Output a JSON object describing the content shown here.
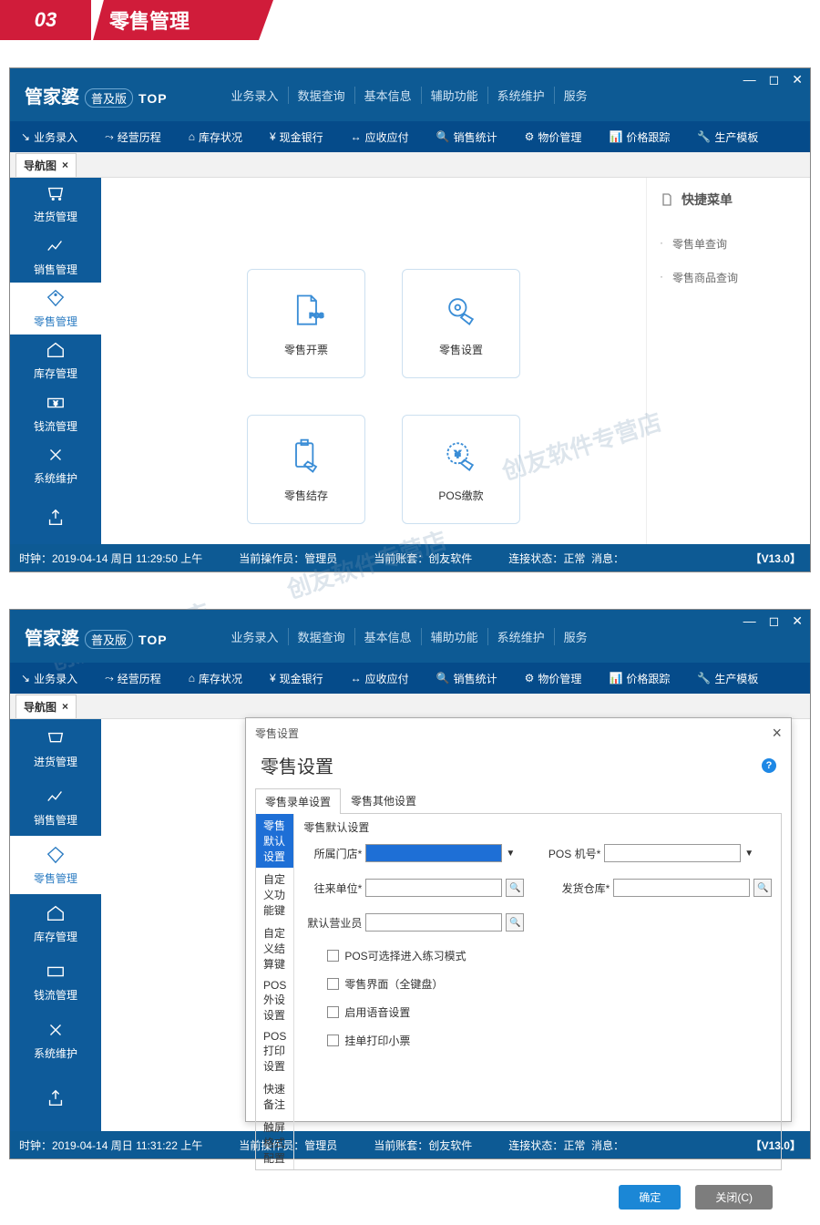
{
  "page_header": {
    "num": "03",
    "title": "零售管理"
  },
  "app": {
    "logo_main": "管家婆",
    "logo_sub": "普及版",
    "logo_top": "TOP",
    "top_menu": [
      "业务录入",
      "数据查询",
      "基本信息",
      "辅助功能",
      "系统维护",
      "服务"
    ],
    "toolbar": [
      "业务录入",
      "经营历程",
      "库存状况",
      "现金银行",
      "应收应付",
      "销售统计",
      "物价管理",
      "价格跟踪",
      "生产模板"
    ],
    "toolbar_prefix": [
      "↘",
      "⤳",
      "⌂",
      "¥",
      "↔",
      "🔍",
      "⚙",
      "📊",
      "🔧"
    ],
    "nav_tab": "导航图",
    "sidebar": [
      "进货管理",
      "销售管理",
      "零售管理",
      "库存管理",
      "钱流管理",
      "系统维护",
      ""
    ],
    "sidebar_active_index": 2
  },
  "screen1": {
    "cards": [
      "零售开票",
      "零售设置",
      "零售结存",
      "POS缴款"
    ],
    "quick_header": "快捷菜单",
    "quick_links": [
      "零售单查询",
      "零售商品查询"
    ],
    "status": {
      "clock_label": "时钟：",
      "clock": "2019-04-14 周日 11:29:50 上午",
      "operator_label": "当前操作员：",
      "operator": "管理员",
      "account_label": "当前账套：",
      "account": "创友软件",
      "conn_label": "连接状态：",
      "conn": "正常",
      "msg_label": "消息：",
      "version": "【V13.0】"
    }
  },
  "screen2": {
    "dialog": {
      "breadcrumb": "零售设置",
      "title": "零售设置",
      "tabs": [
        "零售录单设置",
        "零售其他设置"
      ],
      "active_tab": 0,
      "side_items": [
        "零售默认设置",
        "自定义功能键",
        "自定义结算键",
        "POS外设设置",
        "POS打印设置",
        "快速备注",
        "触屏格式配置"
      ],
      "side_active": 0,
      "section_label": "零售默认设置",
      "fields": {
        "store_label": "所属门店*",
        "pos_no_label": "POS 机号*",
        "supplier_label": "往来单位*",
        "warehouse_label": "发货仓库*",
        "clerk_label": "默认营业员"
      },
      "checks": [
        "POS可选择进入练习模式",
        "零售界面（全键盘）",
        "启用语音设置",
        "挂单打印小票"
      ],
      "ok": "确定",
      "cancel": "关闭(C)"
    },
    "status": {
      "clock_label": "时钟：",
      "clock": "2019-04-14 周日 11:31:22 上午",
      "operator_label": "当前操作员：",
      "operator": "管理员",
      "account_label": "当前账套：",
      "account": "创友软件",
      "conn_label": "连接状态：",
      "conn": "正常",
      "msg_label": "消息：",
      "version": "【V13.0】"
    }
  },
  "watermark": "创友软件专营店"
}
